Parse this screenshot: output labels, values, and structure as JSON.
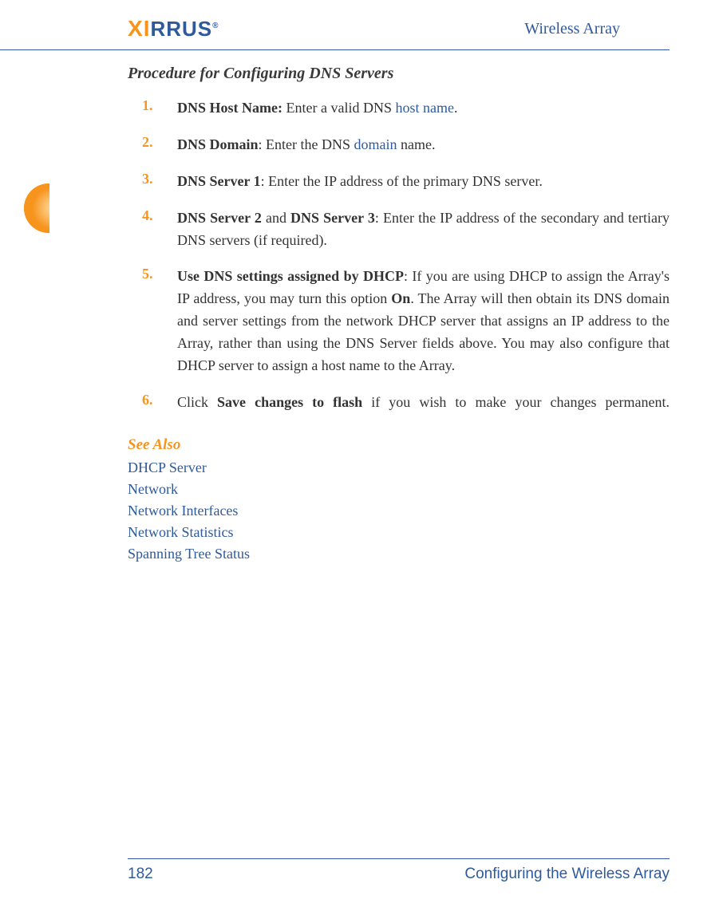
{
  "header": {
    "logo_text1": "X",
    "logo_text2": "I",
    "logo_text3": "RRUS",
    "logo_reg": "®",
    "right": "Wireless Array"
  },
  "section_title": "Procedure for Configuring DNS Servers",
  "steps": {
    "s1": {
      "num": "1.",
      "bold": "DNS Host Name: ",
      "t1": "Enter a valid DNS ",
      "link": "host name",
      "t2": "."
    },
    "s2": {
      "num": "2.",
      "bold": "DNS Domain",
      "t1": ": Enter the DNS ",
      "link": "domain",
      "t2": " name."
    },
    "s3": {
      "num": "3.",
      "bold": "DNS Server 1",
      "t1": ": Enter the IP address of the primary DNS server."
    },
    "s4": {
      "num": "4.",
      "bold1": "DNS Server 2",
      "mid": " and ",
      "bold2": "DNS Server 3",
      "t1": ": Enter the IP address of the secondary and tertiary DNS servers (if required)."
    },
    "s5": {
      "num": "5.",
      "bold1": "Use DNS settings assigned by DHCP",
      "t1": ": If you are using DHCP to assign the Array's IP address, you may turn this option ",
      "bold2": "On",
      "t2": ". The Array will then obtain its DNS domain and server settings from the network DHCP server that assigns an IP address to the Array, rather than using the DNS Server fields above. You may also configure that DHCP server to assign a host name to the Array."
    },
    "s6": {
      "num": "6.",
      "t1": "Click ",
      "bold": "Save changes to flash",
      "t2": " if you wish to make your changes permanent."
    }
  },
  "see_also": {
    "heading": "See Also",
    "items": [
      "DHCP Server",
      "Network",
      "Network Interfaces",
      "Network Statistics",
      "Spanning Tree Status"
    ]
  },
  "footer": {
    "page": "182",
    "title": "Configuring the Wireless Array"
  }
}
